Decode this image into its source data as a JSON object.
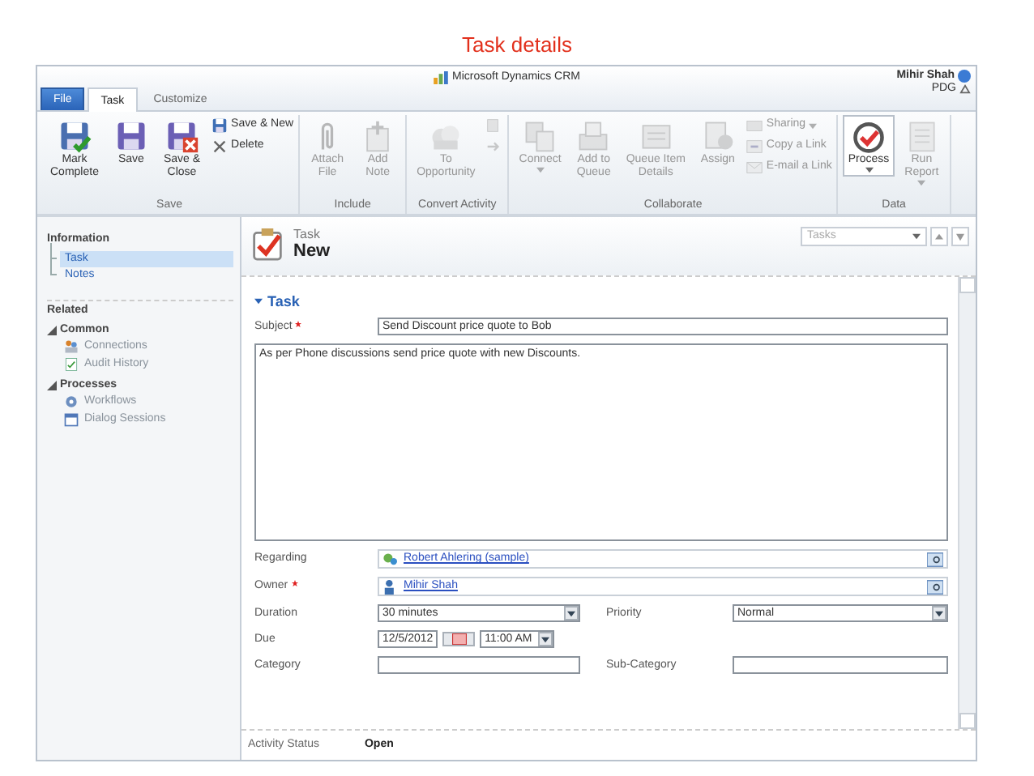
{
  "slide_title": "Task details",
  "app": {
    "product": "Microsoft Dynamics CRM",
    "user": "Mihir Shah",
    "organization": "PDG"
  },
  "tabs": [
    {
      "label": "File",
      "kind": "file",
      "selected": false
    },
    {
      "label": "Task",
      "kind": "tab",
      "selected": true
    },
    {
      "label": "Customize",
      "kind": "tab",
      "selected": false
    }
  ],
  "ribbon": [
    {
      "label": "Save",
      "buttons": [
        {
          "kind": "large",
          "label": "Mark\nComplete",
          "disabled": false
        },
        {
          "kind": "large",
          "label": "Save",
          "disabled": false
        },
        {
          "kind": "large",
          "label": "Save &\nClose",
          "disabled": false
        },
        {
          "kind": "small",
          "label": "Save & New",
          "disabled": false
        },
        {
          "kind": "small",
          "label": "Delete",
          "disabled": false
        }
      ]
    },
    {
      "label": "Include",
      "buttons": [
        {
          "kind": "large",
          "label": "Attach\nFile",
          "disabled": true
        },
        {
          "kind": "large",
          "label": "Add\nNote",
          "disabled": true
        }
      ]
    },
    {
      "label": "Convert Activity",
      "buttons": [
        {
          "kind": "large",
          "label": "To\nOpportunity",
          "disabled": true
        },
        {
          "kind": "icon",
          "disabled": true
        },
        {
          "kind": "icon",
          "disabled": true
        }
      ]
    },
    {
      "label": "Collaborate",
      "buttons": [
        {
          "kind": "large",
          "label": "Connect",
          "menu": true,
          "disabled": true
        },
        {
          "kind": "large",
          "label": "Add to\nQueue",
          "disabled": true
        },
        {
          "kind": "large",
          "label": "Queue Item\nDetails",
          "disabled": true
        },
        {
          "kind": "large",
          "label": "Assign",
          "disabled": true
        },
        {
          "kind": "small",
          "label": "Sharing",
          "menu": true,
          "disabled": true
        },
        {
          "kind": "small",
          "label": "Copy a Link",
          "disabled": true
        },
        {
          "kind": "small",
          "label": "E-mail a Link",
          "disabled": true
        }
      ]
    },
    {
      "label": "Data",
      "buttons": [
        {
          "kind": "large",
          "label": "Process",
          "menu": true,
          "disabled": false
        },
        {
          "kind": "large",
          "label": "Run\nReport",
          "menu": true,
          "disabled": true
        }
      ]
    }
  ],
  "nav": {
    "information": {
      "title": "Information",
      "items": [
        {
          "label": "Task",
          "selected": true
        },
        {
          "label": "Notes",
          "selected": false
        }
      ]
    },
    "related": {
      "title": "Related",
      "groups": [
        {
          "label": "Common",
          "expanded": true,
          "items": [
            {
              "label": "Connections"
            },
            {
              "label": "Audit History"
            }
          ]
        },
        {
          "label": "Processes",
          "expanded": true,
          "items": [
            {
              "label": "Workflows"
            },
            {
              "label": "Dialog Sessions"
            }
          ]
        }
      ]
    }
  },
  "record": {
    "entity": "Task",
    "name": "New",
    "view_selector": "Tasks"
  },
  "form": {
    "section": {
      "title": "Task",
      "expanded": true
    },
    "rows": [
      [
        {
          "kind": "text",
          "label": "Subject",
          "required": true,
          "value": "Send Discount price quote to Bob"
        }
      ],
      [
        {
          "kind": "memo",
          "value": "As per Phone discussions send price quote with new Discounts."
        }
      ],
      [
        {
          "kind": "lookup",
          "label": "Regarding",
          "required": false,
          "value": "Robert Ahlering (sample)"
        }
      ],
      [
        {
          "kind": "lookup",
          "label": "Owner",
          "required": true,
          "value": "Mihir Shah"
        }
      ],
      [
        {
          "kind": "select",
          "label": "Duration",
          "required": false,
          "value": "30 minutes"
        },
        {
          "kind": "select",
          "label": "Priority",
          "required": false,
          "value": "Normal"
        }
      ],
      [
        {
          "kind": "datetime",
          "label": "Due",
          "required": false,
          "date": "12/5/2012",
          "time": "11:00 AM"
        }
      ],
      [
        {
          "kind": "text",
          "label": "Category",
          "required": false
        },
        {
          "kind": "text",
          "label": "Sub-Category",
          "required": false
        }
      ]
    ]
  },
  "footer": {
    "label": "Activity Status",
    "value": "Open"
  }
}
